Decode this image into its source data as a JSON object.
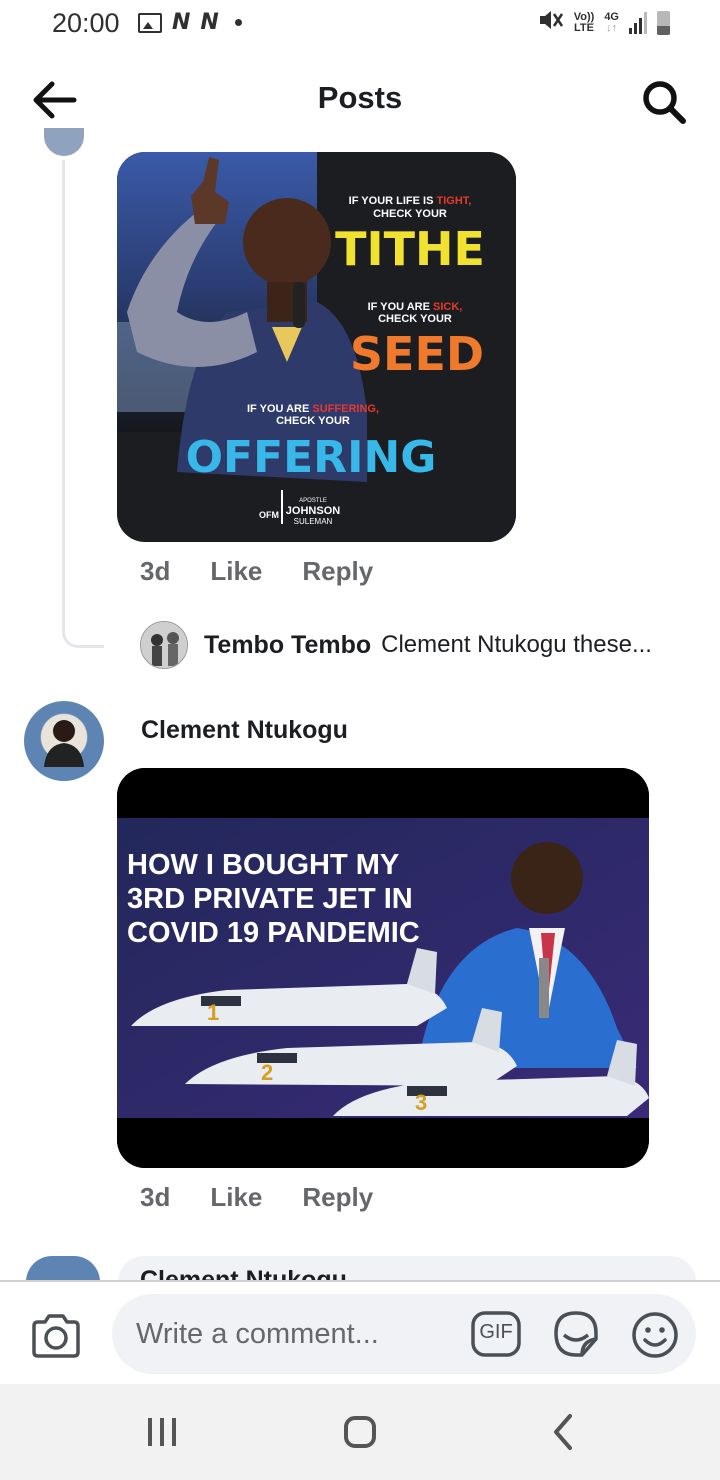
{
  "status_bar": {
    "time": "20:00",
    "left_icons": [
      "image-icon",
      "n-icon",
      "n-icon",
      "dot-icon"
    ],
    "carrier_label_top": "Vo))",
    "carrier_label_bottom": "LTE",
    "network_label": "4G",
    "right_icons": [
      "mute-icon",
      "volte-icon",
      "4g-icon",
      "signal-icon",
      "battery-icon"
    ]
  },
  "header": {
    "title": "Posts",
    "back_icon": "arrow-left-icon",
    "search_icon": "search-icon"
  },
  "thread": {
    "reply_image": {
      "lines": [
        {
          "prefix": "IF YOUR LIFE IS ",
          "highlight": "TIGHT,",
          "rest": "CHECK YOUR",
          "big": "TITHE"
        },
        {
          "prefix": "IF YOU ARE ",
          "highlight": "SICK,",
          "rest": "CHECK YOUR",
          "big": "SEED"
        },
        {
          "prefix": "IF YOU ARE ",
          "highlight": "SUFFERING,",
          "rest": "CHECK YOUR",
          "big": "OFFERING"
        }
      ],
      "signature_top": "APOSTLE",
      "signature_main": "JOHNSON",
      "signature_bottom": "SULEMAN",
      "logo_text": "OFM"
    },
    "reply_actions": {
      "time": "3d",
      "like": "Like",
      "reply": "Reply"
    },
    "nested_reply": {
      "name": "Tembo Tembo",
      "text": "Clement Ntukogu these..."
    }
  },
  "comment": {
    "author": "Clement Ntukogu",
    "image": {
      "headline_line1": "HOW I BOUGHT MY",
      "headline_line2": "3RD PRIVATE JET IN",
      "headline_line3": "COVID 19 PANDEMIC",
      "jet_labels": [
        "1",
        "2",
        "3"
      ]
    },
    "actions": {
      "time": "3d",
      "like": "Like",
      "reply": "Reply"
    }
  },
  "next_comment": {
    "author_partial": "Clement Ntukogu"
  },
  "composer": {
    "placeholder": "Write a comment...",
    "camera_icon": "camera-icon",
    "gif_label": "GIF",
    "sticker_icon": "sticker-icon",
    "emoji_icon": "emoji-icon"
  },
  "nav_bar": {
    "icons": [
      "recent-apps-icon",
      "home-icon",
      "back-icon"
    ]
  },
  "colors": {
    "meta_text": "#65676b",
    "thread_line": "#e4e6eb",
    "bubble_bg": "#f0f2f5",
    "tithe_yellow": "#f2e230",
    "seed_orange": "#f07a2c",
    "offering_blue": "#37b8e8",
    "highlight_red": "#e8382c"
  }
}
